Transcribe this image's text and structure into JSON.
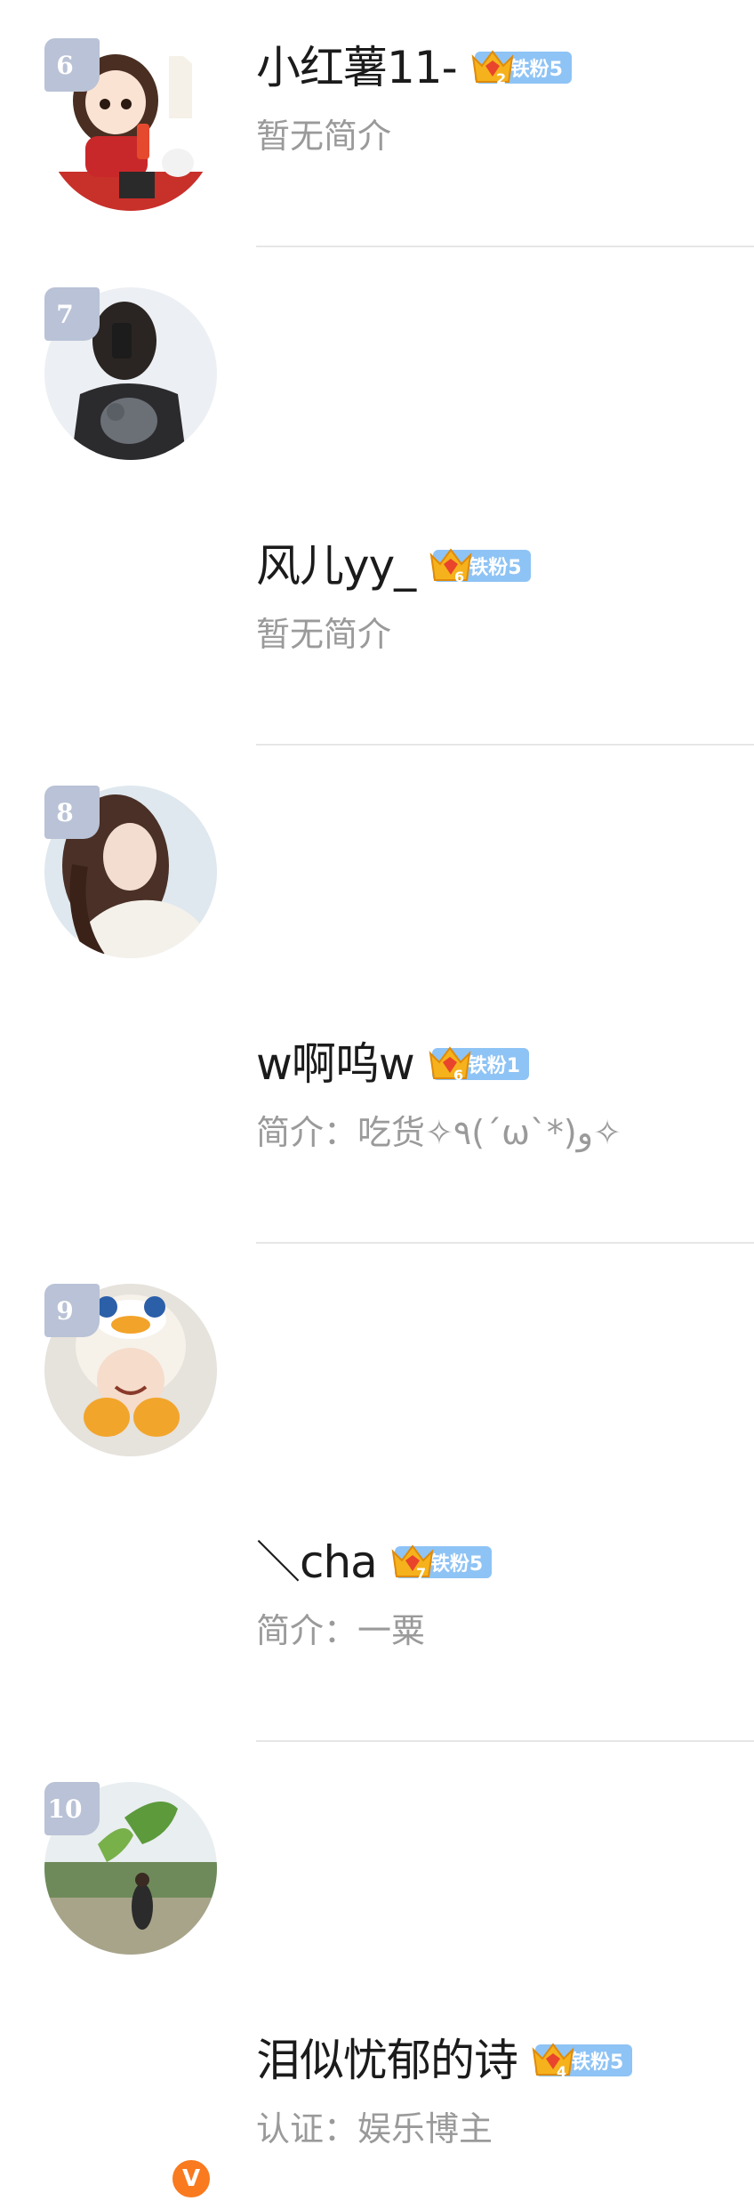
{
  "users": [
    {
      "rank": "6",
      "name": "小红薯11-",
      "fan_level": "2",
      "fan_badge": "铁粉5",
      "intro": "暂无简介",
      "avatar": "avatar-cartoon-girl-red-sweater",
      "verified": false
    },
    {
      "rank": "7",
      "name": "风儿yy_",
      "fan_level": "6",
      "fan_badge": "铁粉5",
      "intro": "暂无简介",
      "avatar": "avatar-girl-mirror-selfie",
      "verified": false
    },
    {
      "rank": "8",
      "name": "w啊呜w",
      "fan_level": "6",
      "fan_badge": "铁粉1",
      "intro": "简介：吃货✧٩(ˊωˋ*)و✧",
      "avatar": "avatar-girl-long-hair",
      "verified": false
    },
    {
      "rank": "9",
      "name": "＼cha",
      "fan_level": "7",
      "fan_badge": "铁粉5",
      "intro": "简介：一粟",
      "avatar": "avatar-child-duck-hat",
      "verified": false
    },
    {
      "rank": "10",
      "name": "泪似忧郁的诗",
      "fan_level": "4",
      "fan_badge": "铁粉5",
      "intro": "认证：娱乐博主",
      "avatar": "avatar-girl-field-kite",
      "verified": true,
      "verified_mark": "V"
    }
  ],
  "colors": {
    "rank_badge": "#b9c2d6",
    "fan_pill": "#8ec3f5",
    "crown": "#f5b21c",
    "verified": "#f97a1f",
    "intro_text": "#9a9a9a"
  }
}
